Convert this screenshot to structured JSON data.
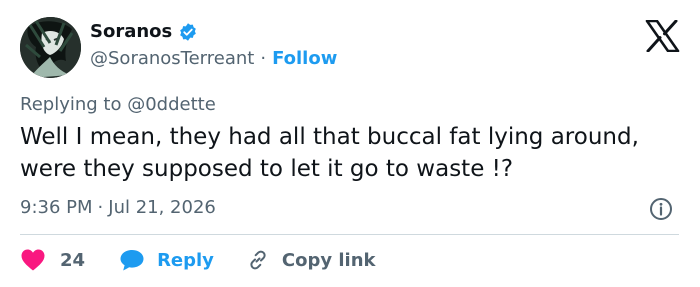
{
  "author": {
    "name": "Soranos",
    "handle": "@SoranosTerreant",
    "separator": "·",
    "follow_label": "Follow",
    "verified": true
  },
  "reply": {
    "prefix": "Replying to",
    "mention": "@0ddette"
  },
  "tweet": {
    "text": "Well I mean, they had all that buccal fat lying around, were they supposed to let it go to waste !?",
    "time": "9:36 PM",
    "separator": "·",
    "date": "Jul 21, 2026"
  },
  "actions": {
    "like_count": "24",
    "reply_label": "Reply",
    "copy_link_label": "Copy link"
  },
  "icons": {
    "logo": "x-logo-icon",
    "verified": "verified-badge-icon",
    "info": "info-icon",
    "like": "heart-icon",
    "reply": "speech-bubble-icon",
    "copy": "link-icon"
  },
  "colors": {
    "accent": "#1d9bf0",
    "like": "#f91880",
    "text": "#0f1419",
    "muted": "#536471",
    "divider": "#cfd9de"
  }
}
